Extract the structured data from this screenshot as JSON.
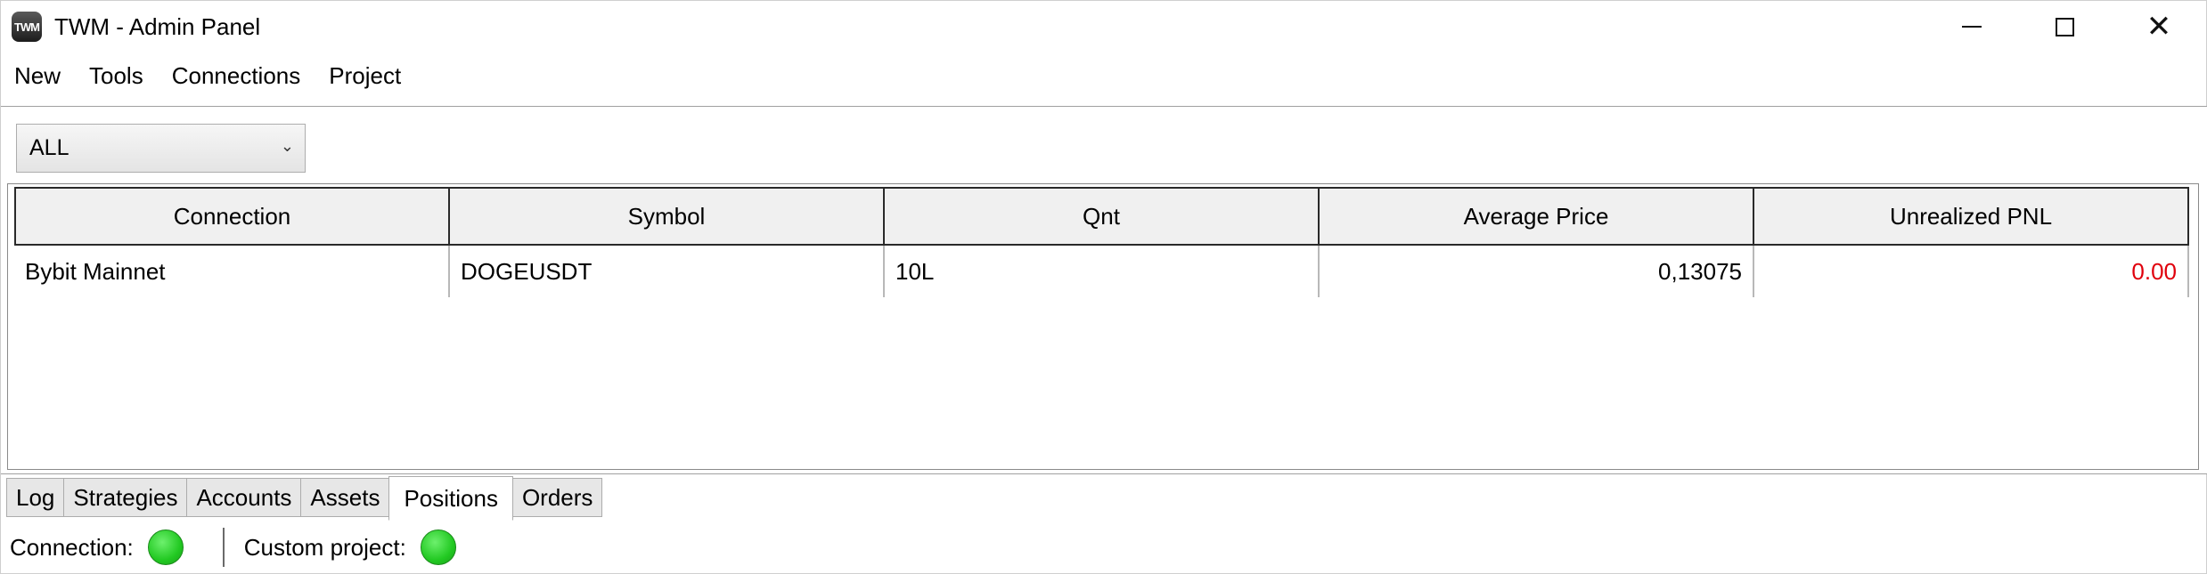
{
  "window": {
    "title": "TWM - Admin Panel",
    "icon_text": "TWM"
  },
  "menu": {
    "items": [
      "New",
      "Tools",
      "Connections",
      "Project"
    ]
  },
  "filter": {
    "selected": "ALL"
  },
  "positions_table": {
    "columns": [
      "Connection",
      "Symbol",
      "Qnt",
      "Average Price",
      "Unrealized PNL"
    ],
    "rows": [
      {
        "connection": "Bybit Mainnet",
        "symbol": "DOGEUSDT",
        "qnt": "10L",
        "average_price": "0,13075",
        "unrealized_pnl": "0.00"
      }
    ]
  },
  "tabs": {
    "items": [
      "Log",
      "Strategies",
      "Accounts",
      "Assets",
      "Positions",
      "Orders"
    ],
    "active": "Positions"
  },
  "status": {
    "connection_label": "Connection:",
    "custom_project_label": "Custom project:",
    "connection_color": "#22c922",
    "custom_project_color": "#22c922"
  },
  "colors": {
    "negative_pnl": "#e0000c",
    "header_bg": "#f0f0f0"
  }
}
